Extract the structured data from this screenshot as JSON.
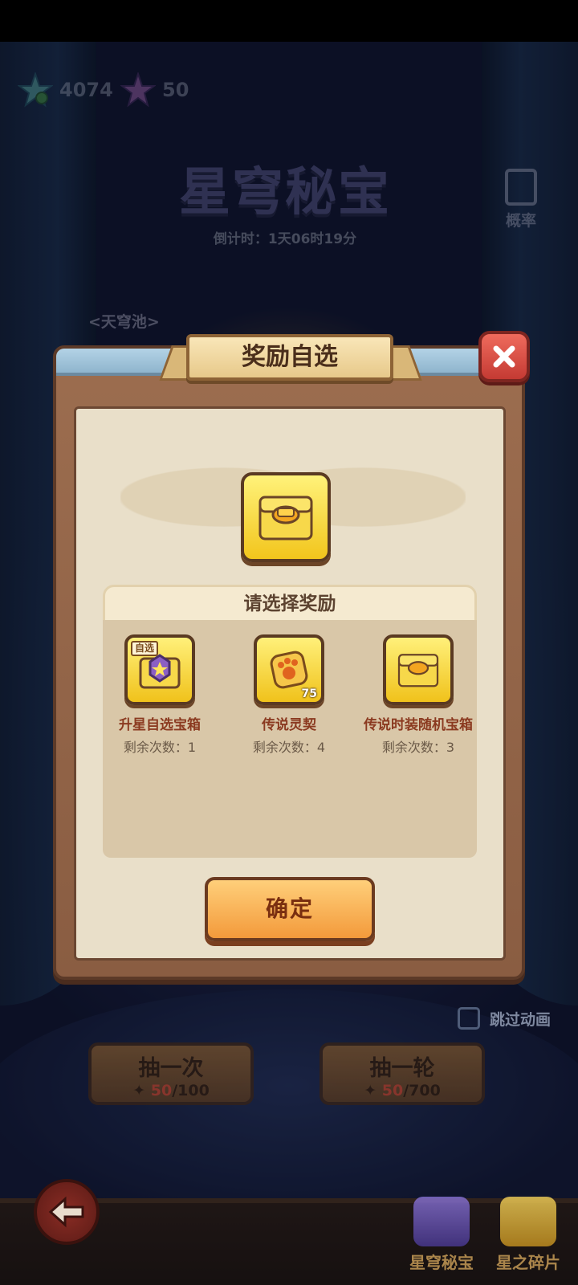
{
  "currencies": [
    {
      "icon": "green-star-gem-icon",
      "value": "4074"
    },
    {
      "icon": "rainbow-star-gem-icon",
      "value": "50"
    }
  ],
  "event": {
    "title": "星穹秘宝",
    "countdown": "倒计时：1天06时19分",
    "probability_label": "概率",
    "pool_label": "<天穹池>"
  },
  "modal": {
    "title": "奖励自选",
    "section_title": "请选择奖励",
    "confirm_label": "确定",
    "items": [
      {
        "name": "升星自选宝箱",
        "count": "剩余次数：1",
        "tag": "自选",
        "qty": ""
      },
      {
        "name": "传说灵契",
        "count": "剩余次数：4",
        "tag": "",
        "qty": "75"
      },
      {
        "name": "传说时装随机宝箱",
        "count": "剩余次数：3",
        "tag": "",
        "qty": ""
      }
    ]
  },
  "controls": {
    "skip_animation": "跳过动画",
    "draw_once": {
      "label": "抽一次",
      "have": "50",
      "need": "/100"
    },
    "draw_round": {
      "label": "抽一轮",
      "have": "50",
      "need": "/700"
    }
  },
  "tabs": [
    {
      "label": "星穹秘宝"
    },
    {
      "label": "星之碎片"
    }
  ],
  "colors": {
    "accent_orange": "#f39a3b",
    "gold": "#f2c51c",
    "close_red": "#c43a33"
  }
}
